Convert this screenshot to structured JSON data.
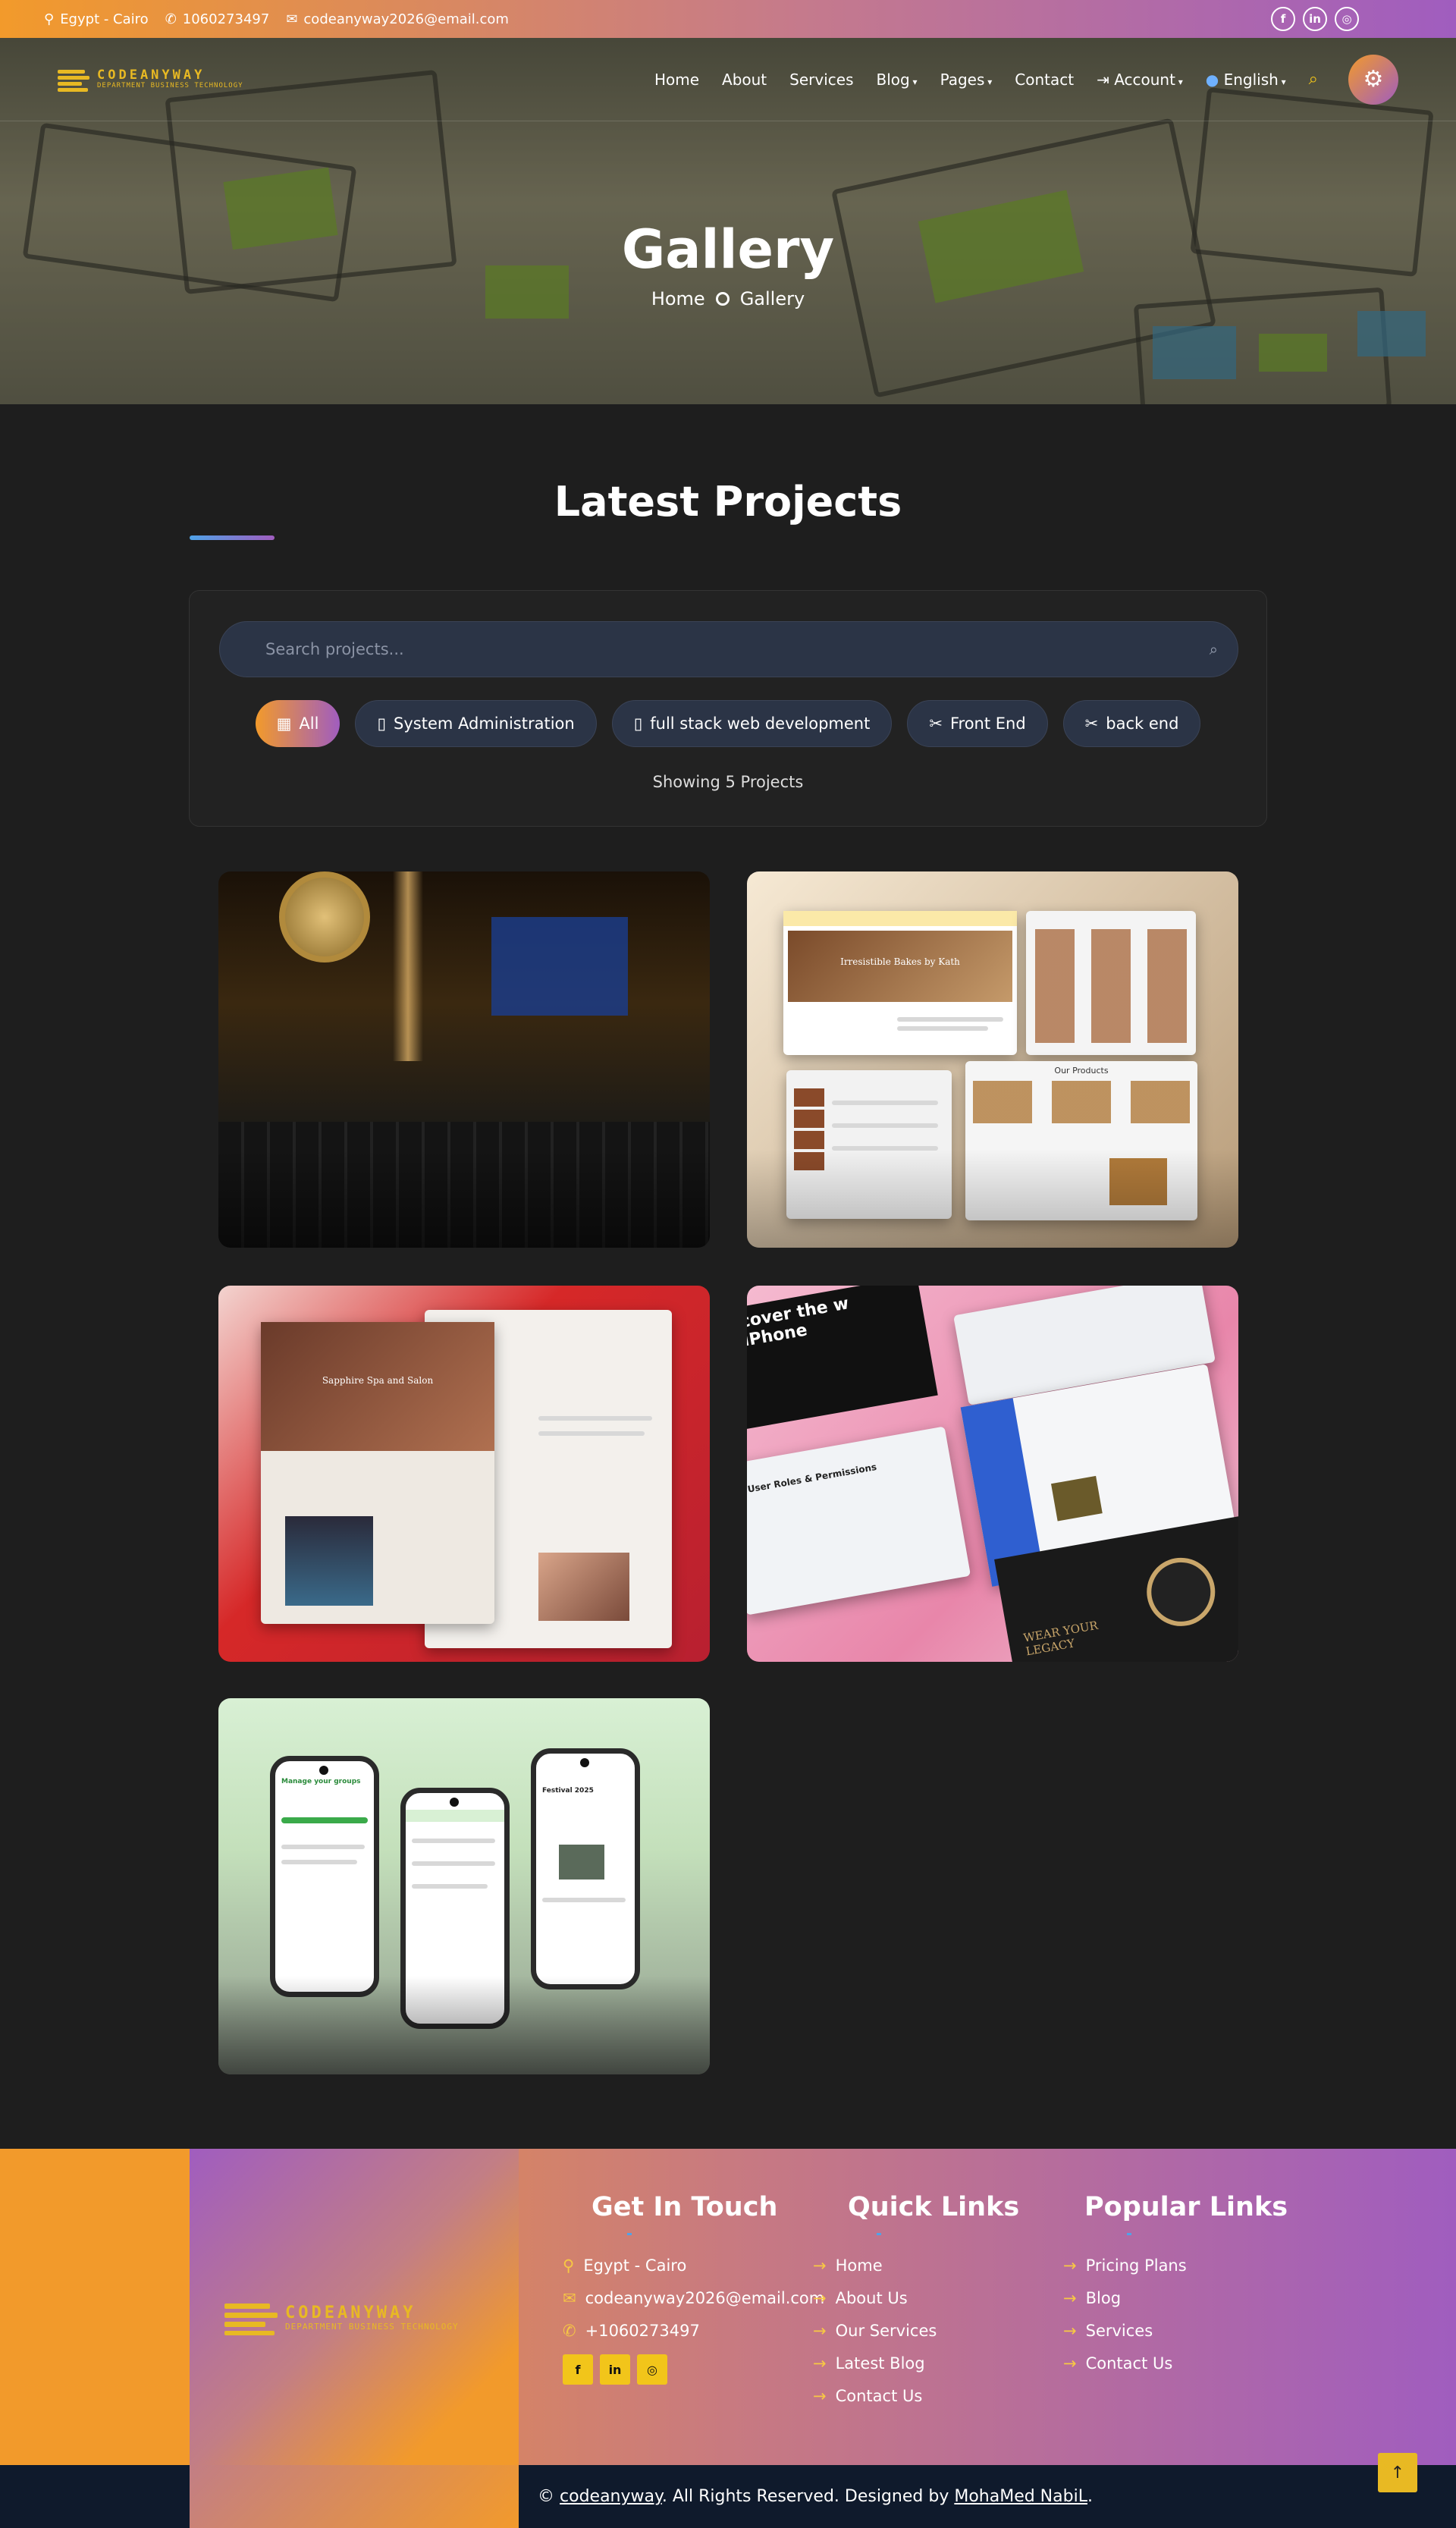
{
  "topbar": {
    "location": "Egypt - Cairo",
    "phone": "1060273497",
    "email": "codeanyway2026@email.com"
  },
  "nav": {
    "logo_name": "CODEANYWAY",
    "logo_tagline": "DEPARTMENT BUSINESS TECHNOLOGY",
    "items": [
      "Home",
      "About",
      "Services",
      "Blog",
      "Pages",
      "Contact",
      "Account",
      "English"
    ]
  },
  "hero": {
    "title": "Gallery",
    "breadcrumb_home": "Home",
    "breadcrumb_current": "Gallery"
  },
  "projects": {
    "title": "Latest Projects",
    "search_placeholder": "Search projects...",
    "filters": [
      "All",
      "System Administration",
      "full stack web development",
      "Front End",
      "back end"
    ],
    "active_filter": "All",
    "count_text": "Showing 5 Projects"
  },
  "cards": {
    "c2_heading": "Irresistible Bakes by Kath",
    "c2_products": "Our Products",
    "c3_heading": "Sapphire Spa and Salon",
    "c4_promo": "cover the w iPhone",
    "c4_roles": "User Roles & Permissions",
    "c4_watch": "WEAR YOUR LEGACY",
    "c5_heading": "Manage your groups",
    "c5_event": "Festival 2025"
  },
  "footer": {
    "contact_title": "Get In Touch",
    "contact_items": [
      "Egypt - Cairo",
      "codeanyway2026@email.com",
      "+1060273497"
    ],
    "quick_title": "Quick Links",
    "quick_links": [
      "Home",
      "About Us",
      "Our Services",
      "Latest Blog",
      "Contact Us"
    ],
    "popular_title": "Popular Links",
    "popular_links": [
      "Pricing Plans",
      "Blog",
      "Services",
      "Contact Us"
    ],
    "copyright_prefix": "©",
    "copyright_brand": "codeanyway",
    "copyright_mid": ". All Rights Reserved. Designed by",
    "copyright_author": "MohaMed NabiL",
    "copyright_end": "."
  },
  "colors": {
    "accent_orange": "#f29a2b",
    "accent_purple": "#a05dbf",
    "dark_bg": "#1e1e1e",
    "chip_bg": "#2b3446",
    "logo_gold": "#e8b923"
  },
  "icons": [
    "map-pin-icon",
    "phone-icon",
    "envelope-icon",
    "facebook-icon",
    "linkedin-icon",
    "instagram-icon",
    "globe-icon",
    "search-icon",
    "gear-icon",
    "grid-icon",
    "mobile-icon",
    "tools-icon",
    "arrow-right-icon",
    "arrow-up-icon"
  ]
}
